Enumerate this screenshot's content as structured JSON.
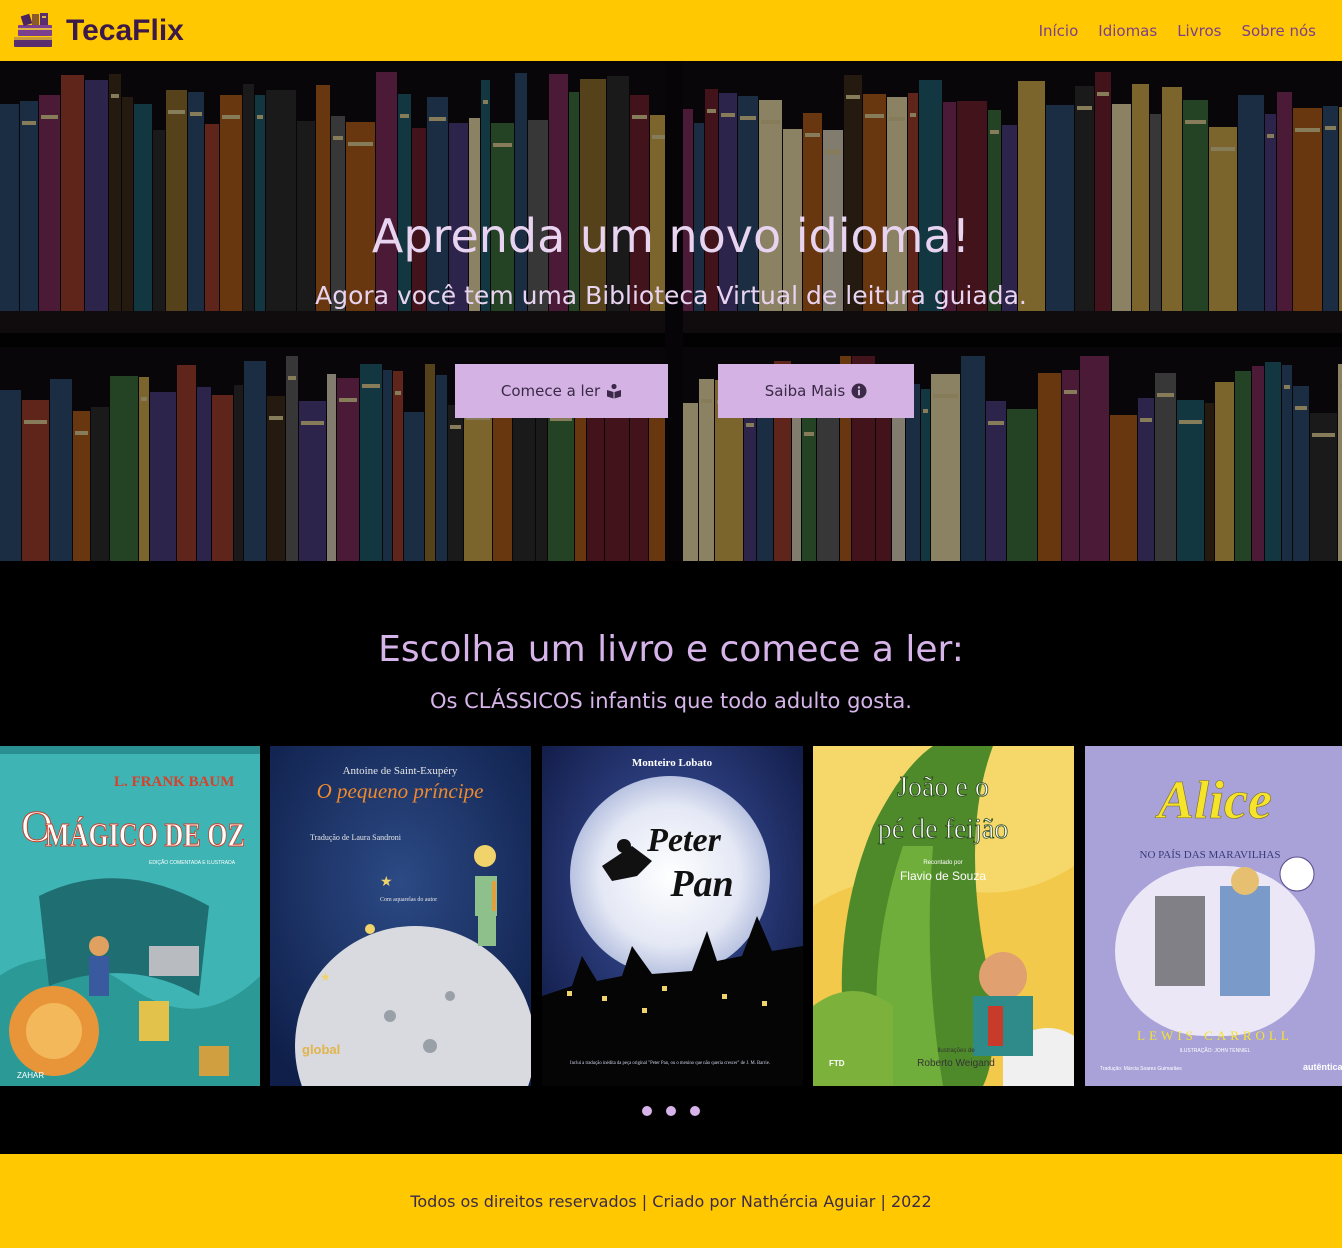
{
  "navbar": {
    "brand": "TecaFlix",
    "brand_icon": "books-stack-icon",
    "links": [
      "Início",
      "Idiomas",
      "Livros",
      "Sobre nós"
    ]
  },
  "hero": {
    "title": "Aprenda um novo idioma!",
    "subtitle": "Agora você tem uma Biblioteca Virtual de leitura guiada.",
    "btn_start": "Comece a ler",
    "btn_start_icon": "book-reader-icon",
    "btn_more": "Saiba Mais",
    "btn_more_icon": "info-circle-icon"
  },
  "books": {
    "title": "Escolha um livro e comece a ler:",
    "subtitle": "Os CLÁSSICOS infantis que todo adulto gosta.",
    "items": [
      {
        "author": "L. FRANK BAUM",
        "title": "MÁGICO DE OZ",
        "title_prefix": "O",
        "edition": "EDIÇÃO COMENTADA E ILUSTRADA",
        "publisher": "ZAHAR"
      },
      {
        "author": "Antoine de Saint-Exupéry",
        "title": "O pequeno príncipe",
        "translator": "Tradução de Laura Sandroni",
        "note": "Com aquarelas do autor",
        "publisher": "global"
      },
      {
        "author": "Monteiro Lobato",
        "title_line1": "Peter",
        "title_line2": "Pan",
        "footnote": "Inclui a tradução inédita da peça original \"Peter Pan, ou o menino que não queria crescer\" de J. M. Barrie."
      },
      {
        "title_line1": "João e o",
        "title_line2": "pé de feijão",
        "retold_label": "Recontado por",
        "author": "Flavio de Souza",
        "illustrator_label": "Ilustrações de",
        "illustrator": "Roberto Weigand",
        "publisher": "FTD"
      },
      {
        "title": "Alice",
        "subtitle": "NO PAÍS DAS MARAVILHAS",
        "author": "LEWIS CARROLL",
        "illustrator": "ILUSTRAÇÃO: JOHN TENNIEL",
        "translator": "Tradução: Márcia Soares Guimarães",
        "publisher": "autêntica"
      }
    ],
    "dots": 3
  },
  "footer": {
    "text": "Todos os direitos reservados | Criado por Nathércia Aguiar | 2022"
  },
  "colors": {
    "navbar_bg": "#ffc800",
    "brand": "#3b1a4a",
    "nav_link": "#7a3f8e",
    "accent_lilac": "#d4b3e4",
    "heading_lilac": "#d6b4ea"
  }
}
